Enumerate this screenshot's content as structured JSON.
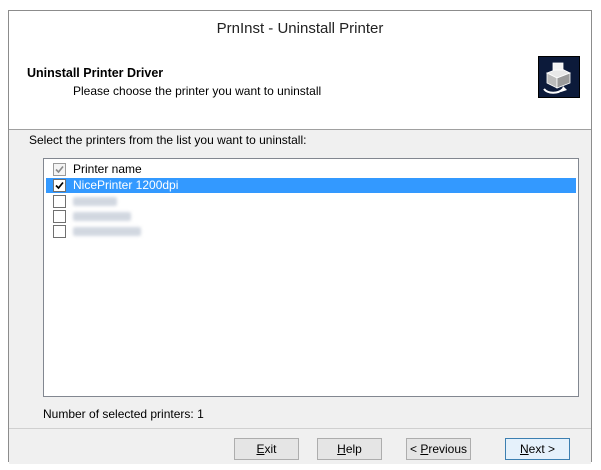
{
  "window": {
    "title": "PrnInst - Uninstall Printer"
  },
  "header": {
    "title": "Uninstall Printer Driver",
    "subtitle": "Please choose the printer you want to uninstall",
    "icon": "printer-uninstall-icon"
  },
  "instruction": "Select the printers from the list you want to uninstall:",
  "list": {
    "header_label": "Printer name",
    "header_checked": true,
    "items": [
      {
        "label": "NicePrinter 1200dpi",
        "checked": true,
        "selected": true,
        "obscured": false
      },
      {
        "label": "",
        "checked": false,
        "selected": false,
        "obscured": true
      },
      {
        "label": "",
        "checked": false,
        "selected": false,
        "obscured": true
      },
      {
        "label": "",
        "checked": false,
        "selected": false,
        "obscured": true
      }
    ]
  },
  "status": {
    "selected_count_text": "Number of selected printers: 1"
  },
  "buttons": {
    "exit": {
      "mnemonic": "E",
      "rest": "xit"
    },
    "help": {
      "mnemonic": "H",
      "rest": "elp"
    },
    "previous": {
      "prefix": "< ",
      "mnemonic": "P",
      "rest": "revious"
    },
    "next": {
      "mnemonic": "N",
      "rest": "ext >"
    }
  },
  "colors": {
    "selection": "#3399ff",
    "accent": "#3c7fb1"
  }
}
